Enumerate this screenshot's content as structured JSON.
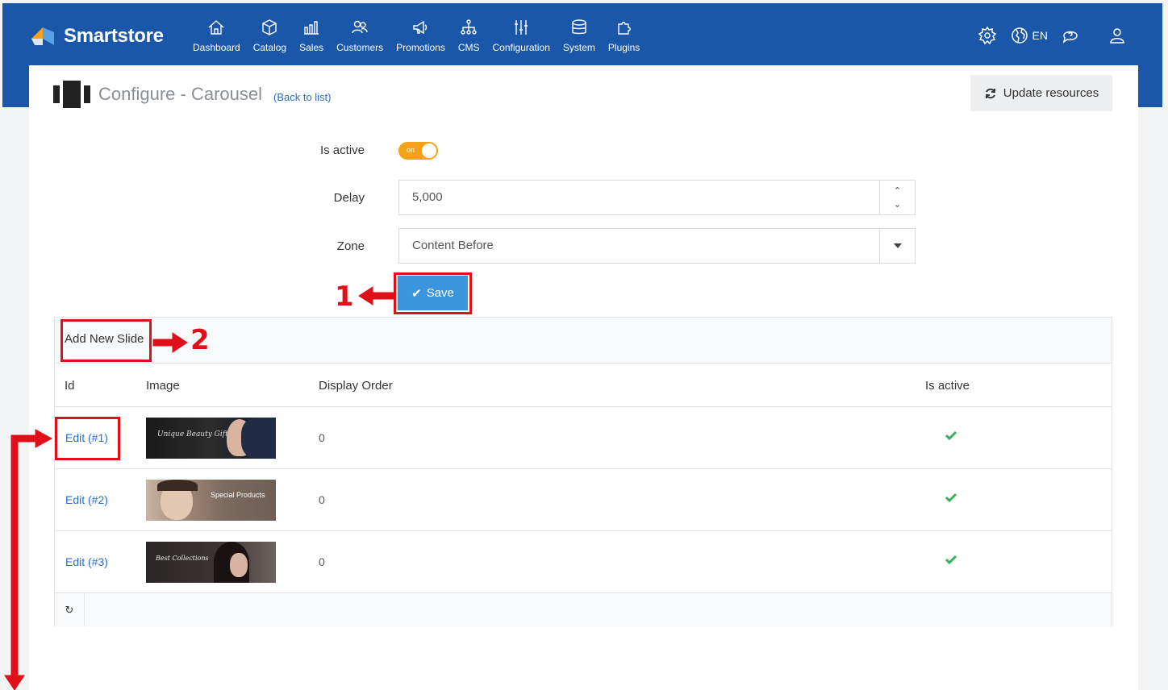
{
  "app": {
    "name": "Smartstore"
  },
  "nav": [
    {
      "label": "Dashboard",
      "icon": "home-icon"
    },
    {
      "label": "Catalog",
      "icon": "cube-icon"
    },
    {
      "label": "Sales",
      "icon": "chart-icon"
    },
    {
      "label": "Customers",
      "icon": "users-icon"
    },
    {
      "label": "Promotions",
      "icon": "megaphone-icon"
    },
    {
      "label": "CMS",
      "icon": "sitemap-icon"
    },
    {
      "label": "Configuration",
      "icon": "sliders-icon"
    },
    {
      "label": "System",
      "icon": "database-icon"
    },
    {
      "label": "Plugins",
      "icon": "puzzle-icon"
    }
  ],
  "topbar": {
    "language": "EN"
  },
  "page": {
    "title": "Configure - Carousel",
    "back_link": "(Back to list)",
    "update_button": "Update resources"
  },
  "form": {
    "is_active_label": "Is active",
    "toggle_text": "on",
    "delay_label": "Delay",
    "delay_value": "5,000",
    "zone_label": "Zone",
    "zone_value": "Content Before",
    "save_label": "Save"
  },
  "grid": {
    "add_button": "Add New Slide",
    "columns": {
      "id": "Id",
      "image": "Image",
      "order": "Display Order",
      "active": "Is active"
    },
    "rows": [
      {
        "edit": "Edit (#1)",
        "order": "0",
        "image_text": "Unique Beauty Gift"
      },
      {
        "edit": "Edit (#2)",
        "order": "0",
        "image_text": "Special Products"
      },
      {
        "edit": "Edit (#3)",
        "order": "0",
        "image_text": "Best Collections"
      }
    ]
  },
  "annotations": {
    "one": "1",
    "two": "2"
  },
  "colors": {
    "header": "#1b57a8",
    "accent": "#f5a11a",
    "save": "#3a95dd",
    "marker": "#e0101a",
    "check": "#3cae5f"
  }
}
